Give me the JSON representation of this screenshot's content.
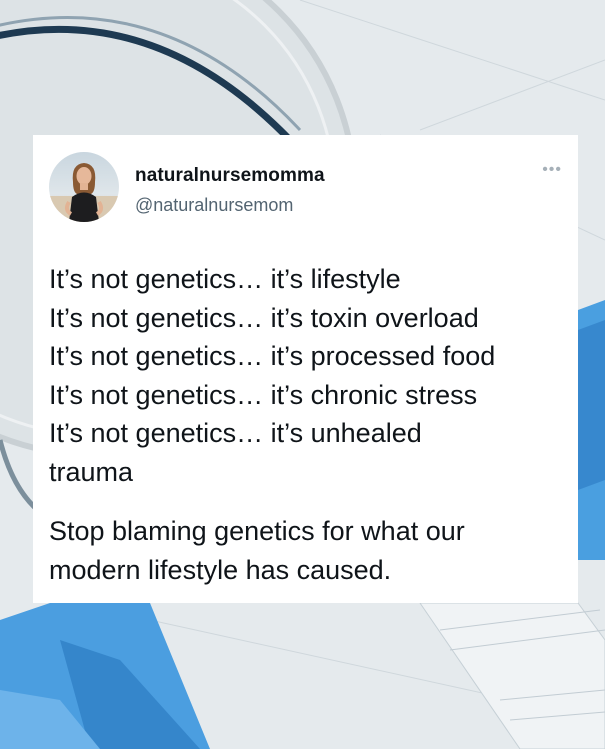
{
  "tweet": {
    "display_name": "naturalnursemomma",
    "handle": "@naturalnursemom",
    "more_icon": "ellipsis-icon",
    "lines": [
      "It’s not genetics… it’s lifestyle",
      "It’s not genetics… it’s toxin overload",
      "It’s not genetics… it’s processed food",
      "It’s not genetics… it’s chronic stress",
      "It’s not genetics… it’s unhealed trauma"
    ],
    "closing": "Stop blaming genetics for what our modern lifestyle has caused."
  },
  "colors": {
    "text": "#0f1419",
    "secondary_text": "#536471",
    "card_background": "#ffffff",
    "accent_blue": "#4a9fe0"
  }
}
